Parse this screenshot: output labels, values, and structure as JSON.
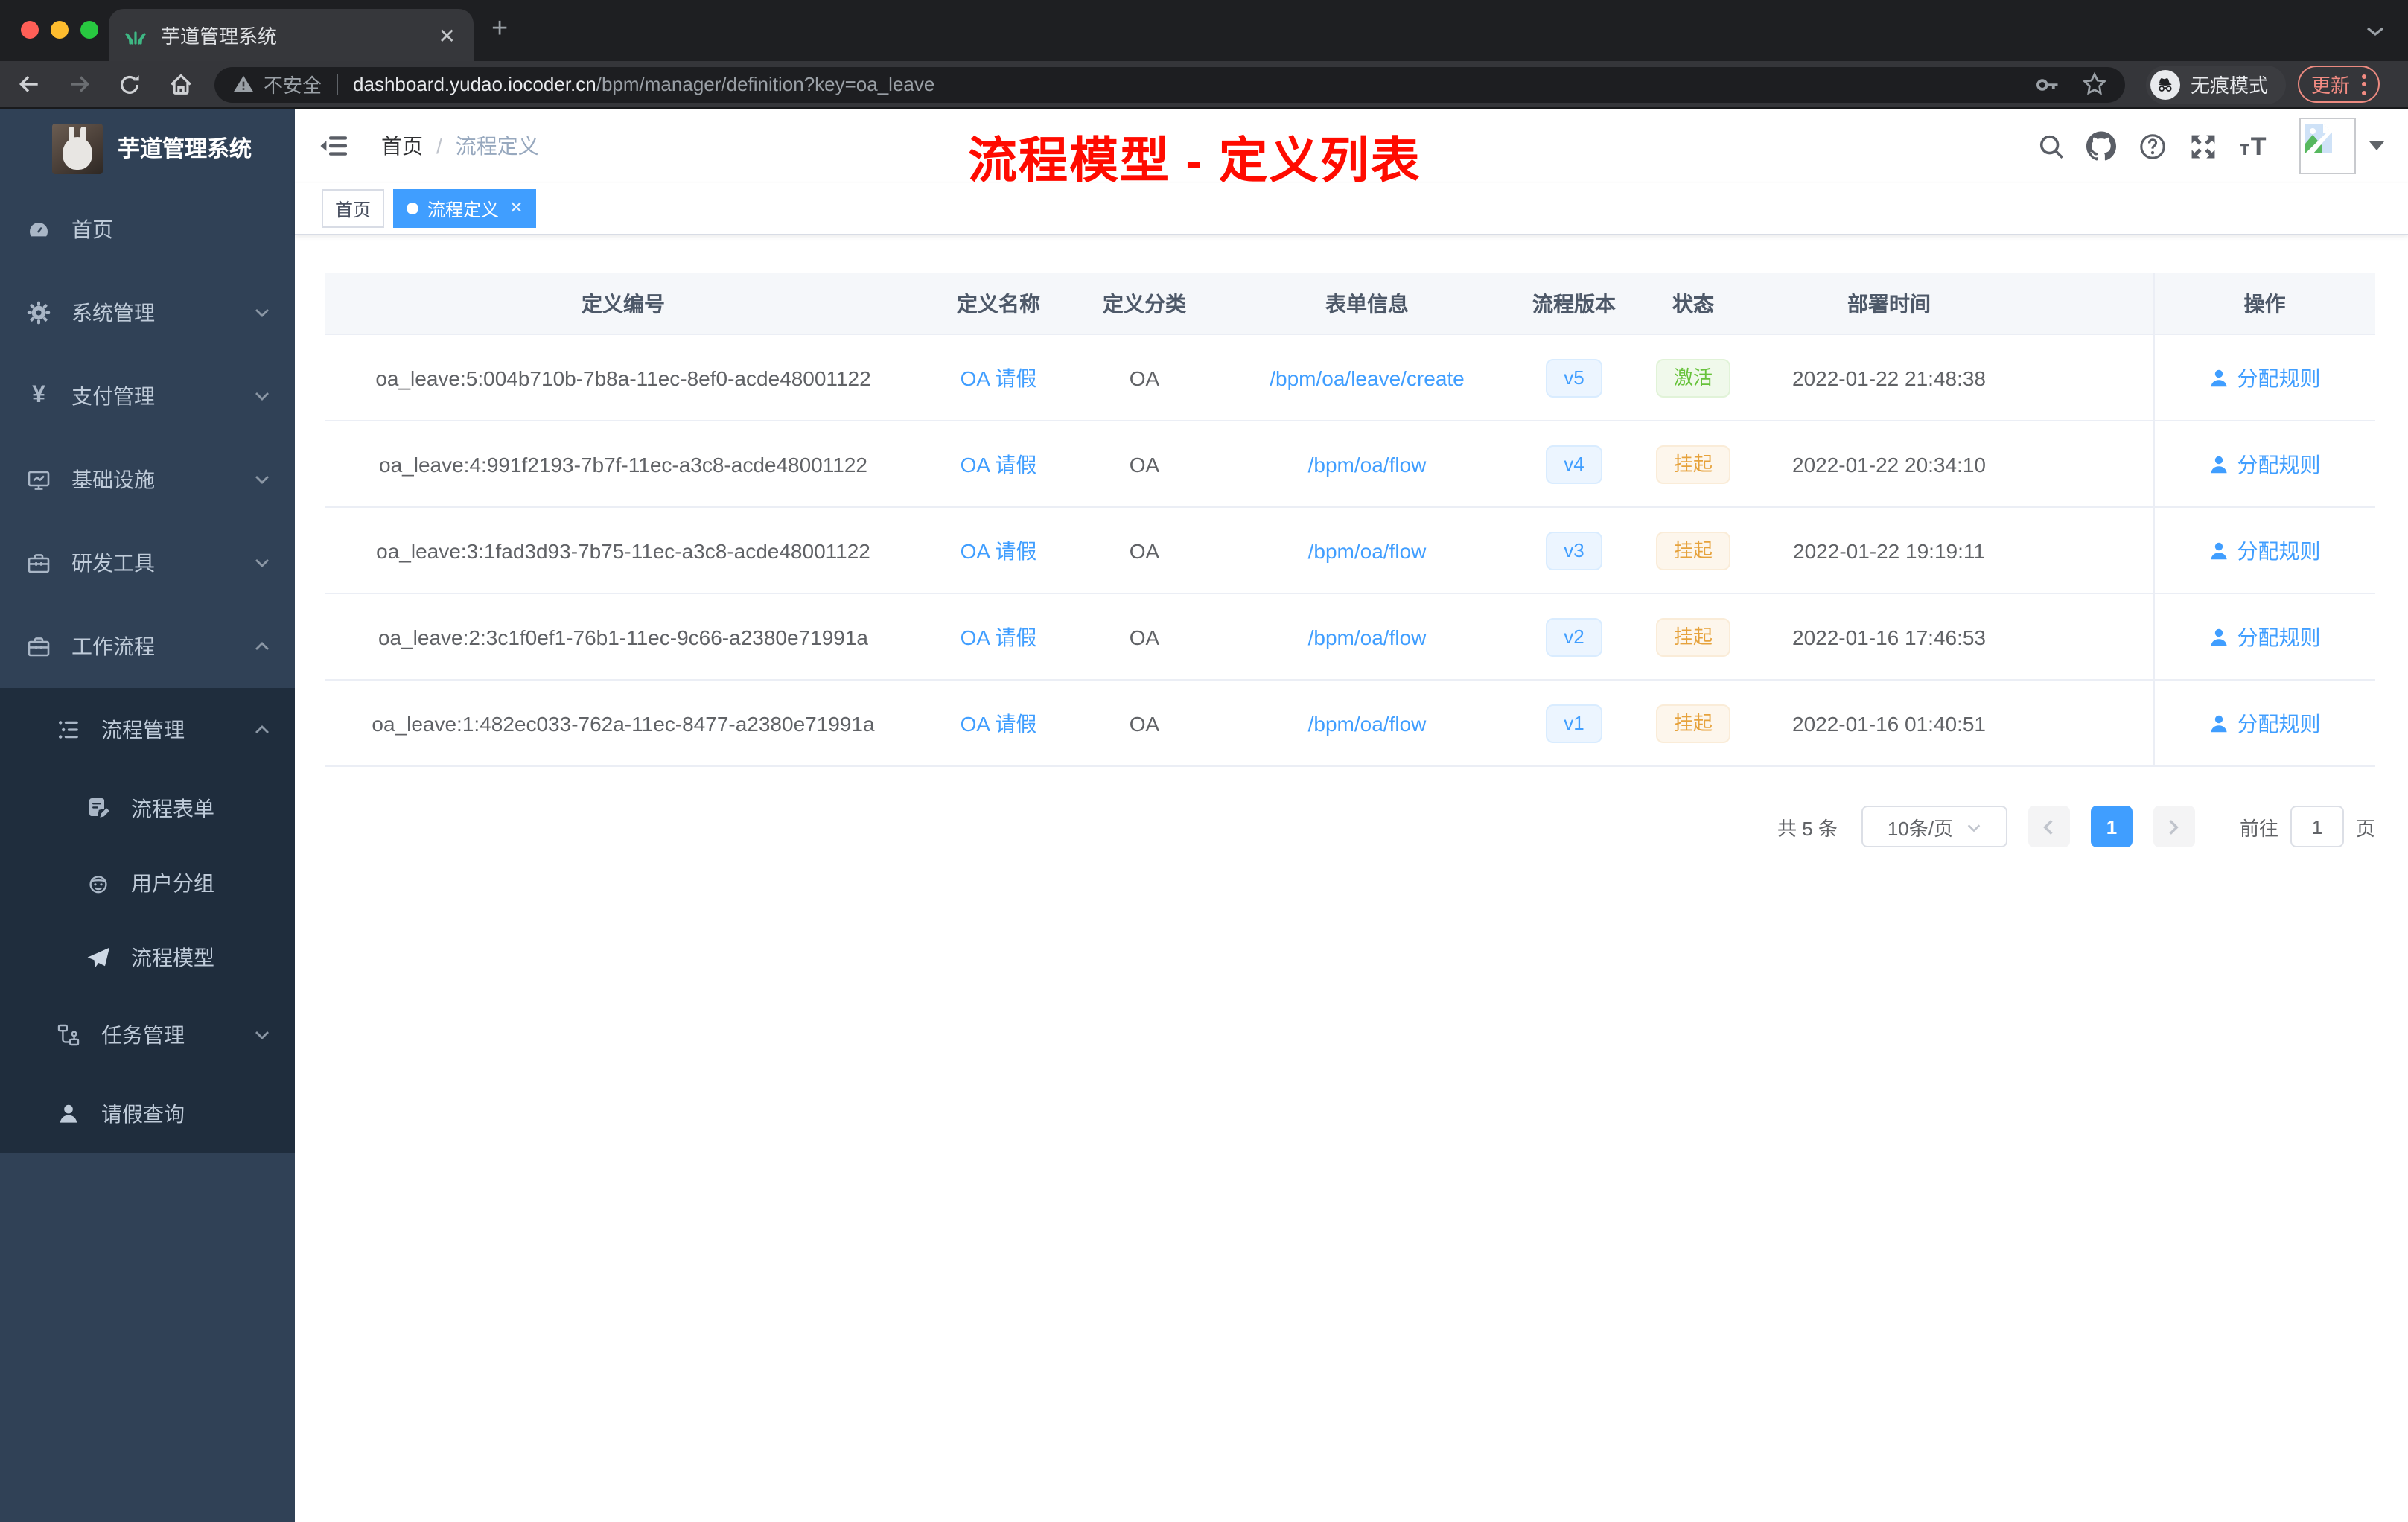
{
  "browser": {
    "tab_title": "芋道管理系统",
    "not_secure_label": "不安全",
    "url_host": "dashboard.yudao.iocoder.cn",
    "url_path": "/bpm/manager/definition?key=oa_leave",
    "incognito_label": "无痕模式",
    "update_label": "更新"
  },
  "sidebar": {
    "logo_title": "芋道管理系统",
    "items": [
      {
        "label": "首页"
      },
      {
        "label": "系统管理"
      },
      {
        "label": "支付管理"
      },
      {
        "label": "基础设施"
      },
      {
        "label": "研发工具"
      },
      {
        "label": "工作流程"
      },
      {
        "label": "流程管理"
      },
      {
        "label": "流程表单"
      },
      {
        "label": "用户分组"
      },
      {
        "label": "流程模型"
      },
      {
        "label": "任务管理"
      },
      {
        "label": "请假查询"
      }
    ]
  },
  "navbar": {
    "breadcrumb": {
      "home": "首页",
      "separator": "/",
      "current": "流程定义"
    }
  },
  "annotation": "流程模型 - 定义列表",
  "tags": {
    "home_label": "首页",
    "active_label": "流程定义"
  },
  "table": {
    "columns": [
      "定义编号",
      "定义名称",
      "定义分类",
      "表单信息",
      "流程版本",
      "状态",
      "部署时间",
      "操作"
    ],
    "rows": [
      {
        "id": "oa_leave:5:004b710b-7b8a-11ec-8ef0-acde48001122",
        "name": "OA 请假",
        "category": "OA",
        "form": "/bpm/oa/leave/create",
        "version": "v5",
        "status": "激活",
        "status_type": "success",
        "deploy_time": "2022-01-22 21:48:38",
        "action": "分配规则"
      },
      {
        "id": "oa_leave:4:991f2193-7b7f-11ec-a3c8-acde48001122",
        "name": "OA 请假",
        "category": "OA",
        "form": "/bpm/oa/flow",
        "version": "v4",
        "status": "挂起",
        "status_type": "warning",
        "deploy_time": "2022-01-22 20:34:10",
        "action": "分配规则"
      },
      {
        "id": "oa_leave:3:1fad3d93-7b75-11ec-a3c8-acde48001122",
        "name": "OA 请假",
        "category": "OA",
        "form": "/bpm/oa/flow",
        "version": "v3",
        "status": "挂起",
        "status_type": "warning",
        "deploy_time": "2022-01-22 19:19:11",
        "action": "分配规则"
      },
      {
        "id": "oa_leave:2:3c1f0ef1-76b1-11ec-9c66-a2380e71991a",
        "name": "OA 请假",
        "category": "OA",
        "form": "/bpm/oa/flow",
        "version": "v2",
        "status": "挂起",
        "status_type": "warning",
        "deploy_time": "2022-01-16 17:46:53",
        "action": "分配规则"
      },
      {
        "id": "oa_leave:1:482ec033-762a-11ec-8477-a2380e71991a",
        "name": "OA 请假",
        "category": "OA",
        "form": "/bpm/oa/flow",
        "version": "v1",
        "status": "挂起",
        "status_type": "warning",
        "deploy_time": "2022-01-16 01:40:51",
        "action": "分配规则"
      }
    ]
  },
  "pagination": {
    "total_label": "共 5 条",
    "page_size_label": "10条/页",
    "current_page": "1",
    "goto_label": "前往",
    "goto_value": "1",
    "page_unit_label": "页"
  },
  "icons": {
    "favicon": "grass-leaf",
    "url_warning": "triangle-exclamation",
    "key": "key",
    "bookmark": "star-outline",
    "incognito": "hat-and-glasses",
    "browser_menu": "vertical-ellipsis-update",
    "hamburger": "collapse-sidebar",
    "search": "magnifier",
    "github": "octocat",
    "help": "question-circle",
    "fullscreen": "expand-arrows",
    "font_size": "text-size",
    "avatar": "broken-image-placeholder",
    "assign_rule": "user-solid"
  },
  "colors": {
    "accent": "#409eff",
    "annotation_red": "#ff0b00",
    "success": "#67c23a",
    "warning": "#e6a23c",
    "sidebar_bg": "#304156",
    "submenu_bg": "#1f2d3d",
    "update_button": "#f28b82"
  }
}
